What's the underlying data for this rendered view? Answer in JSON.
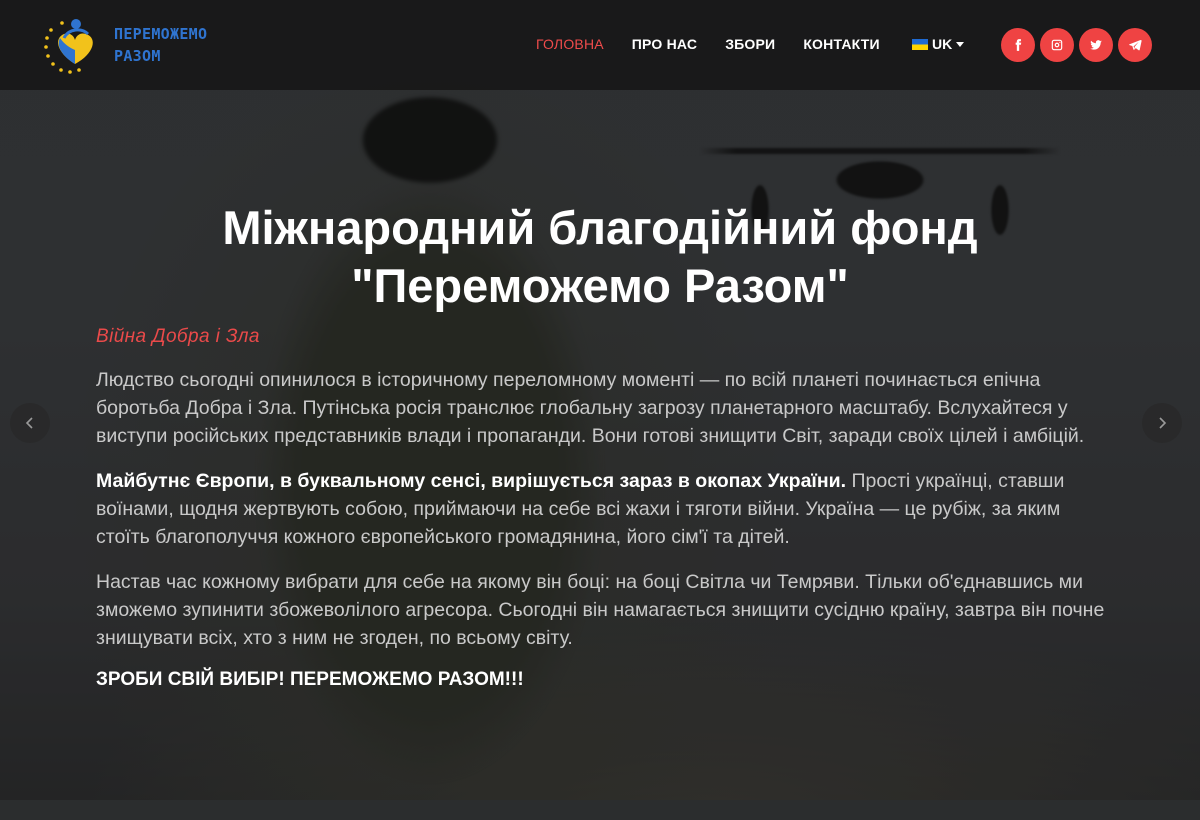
{
  "brand": {
    "name_line1": "ПЕРЕМОЖЕМО",
    "name_line2": "РАЗОМ"
  },
  "nav": {
    "items": [
      {
        "label": "ГОЛОВНА",
        "active": true
      },
      {
        "label": "ПРО НАС",
        "active": false
      },
      {
        "label": "ЗБОРИ",
        "active": false
      },
      {
        "label": "КОНТАКТИ",
        "active": false
      }
    ],
    "language": "UK"
  },
  "socials": [
    {
      "name": "facebook-icon"
    },
    {
      "name": "instagram-icon"
    },
    {
      "name": "twitter-icon"
    },
    {
      "name": "telegram-icon"
    }
  ],
  "hero": {
    "title_line1": "Міжнародний благодійний фонд",
    "title_line2": "\"Переможемо Разом\"",
    "subtitle": "Війна Добра і Зла",
    "paragraph1": "Людство сьогодні опинилося в історичному переломному моменті — по всій планеті починається епічна боротьба Добра і Зла. Путінська росія транслює глобальну загрозу планетарного масштабу. Вслухайтеся у виступи російських представників влади і пропаганди. Вони готові знищити Світ, заради своїх цілей і амбіцій.",
    "paragraph2_bold": "Майбутнє Європи, в буквальному сенсі, вирішується зараз в окопах України.",
    "paragraph2_rest": " Прості українці, ставши воїнами, щодня жертвують собою, приймаючи на себе всі жахи і тяготи війни. Україна — це рубіж, за яким стоїть благополуччя кожного європейського громадянина, його сім'ї та дітей.",
    "paragraph3": "Настав час кожному вибрати для себе на якому він боці: на боці Світла чи Темряви. Тільки об'єднавшись ми зможемо зупинити збожеволілого агресора. Сьогодні він намагається знищити сусідню країну, завтра він почне знищувати всіх, хто з ним не згоден, по всьому світу.",
    "cta": "ЗРОБИ СВІЙ ВИБІР! ПЕРЕМОЖЕМО РАЗОМ!!!"
  },
  "colors": {
    "accent": "#ef4343",
    "active_nav": "#ef4b4b",
    "brand_blue": "#2f74d0",
    "brand_yellow": "#f2c21b"
  },
  "carousel": {
    "prev_icon": "chevron-left-icon",
    "next_icon": "chevron-right-icon"
  }
}
